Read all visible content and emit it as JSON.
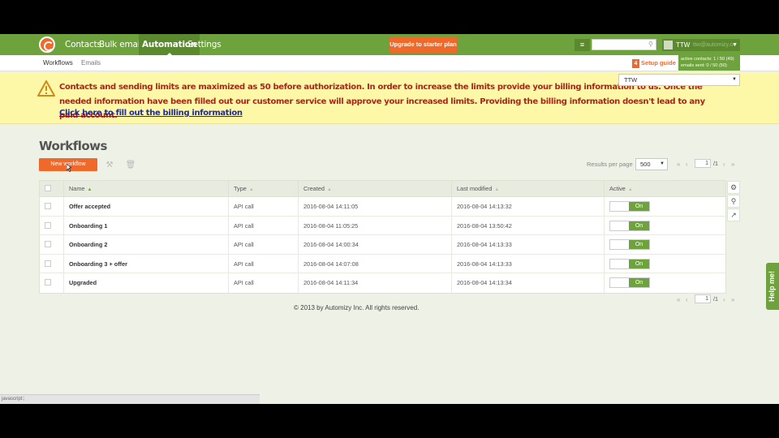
{
  "topnav": {
    "items": [
      "Contacts",
      "Bulk emails",
      "Automation",
      "Settings"
    ],
    "active": "Automation",
    "upgrade_label": "Upgrade to starter plan",
    "user_name": "TTW",
    "user_email": "ttw@automizy.com",
    "search_placeholder": ""
  },
  "subnav": {
    "items": [
      "Workflows",
      "Emails"
    ],
    "setup_guide_badge": "4",
    "setup_guide_label": "Setup guide",
    "limits": [
      "active contacts: 1 / 50 (49)",
      "emails sent: 0 / 50 (50)"
    ]
  },
  "banner": {
    "message": "Contacts and sending limits are maximized as 50 before authorization. In order to increase the limits provide your billing information to us. Once the needed information have been filled out our customer service will approve your increased limits. Providing the billing information doesn't lead to any paid account.",
    "link_label": "Click here to fill out the billing information",
    "account_select": "TTW"
  },
  "main": {
    "title": "Workflows",
    "new_button": "New workflow",
    "results_per_page_label": "Results per page",
    "results_per_page_value": "500",
    "page_current": "1",
    "page_total": "/1",
    "columns": [
      "Name",
      "Type",
      "Created",
      "Last modified",
      "Active"
    ],
    "rows": [
      {
        "name": "Offer accepted",
        "type": "API call",
        "created": "2016-08-04 14:11:05",
        "modified": "2016-08-04 14:13:32",
        "active": "On"
      },
      {
        "name": "Onboarding 1",
        "type": "API call",
        "created": "2016-08-04 11:05:25",
        "modified": "2016-08-04 13:50:42",
        "active": "On"
      },
      {
        "name": "Onboarding 2",
        "type": "API call",
        "created": "2016-08-04 14:00:34",
        "modified": "2016-08-04 14:13:33",
        "active": "On"
      },
      {
        "name": "Onboarding 3 + offer",
        "type": "API call",
        "created": "2016-08-04 14:07:08",
        "modified": "2016-08-04 14:13:33",
        "active": "On"
      },
      {
        "name": "Upgraded",
        "type": "API call",
        "created": "2016-08-04 14:11:34",
        "modified": "2016-08-04 14:13:34",
        "active": "On"
      }
    ]
  },
  "footer": {
    "copyright": "© 2013 by Automizy Inc. All rights reserved.",
    "status_bar": "javascript:;"
  },
  "help_label": "Help me!",
  "colors": {
    "brand_green": "#6ea23c",
    "accent_orange": "#ef6a2a",
    "warning_bg": "#fdf7a8",
    "warning_text": "#b3201a",
    "link_blue": "#1d2aa8"
  }
}
